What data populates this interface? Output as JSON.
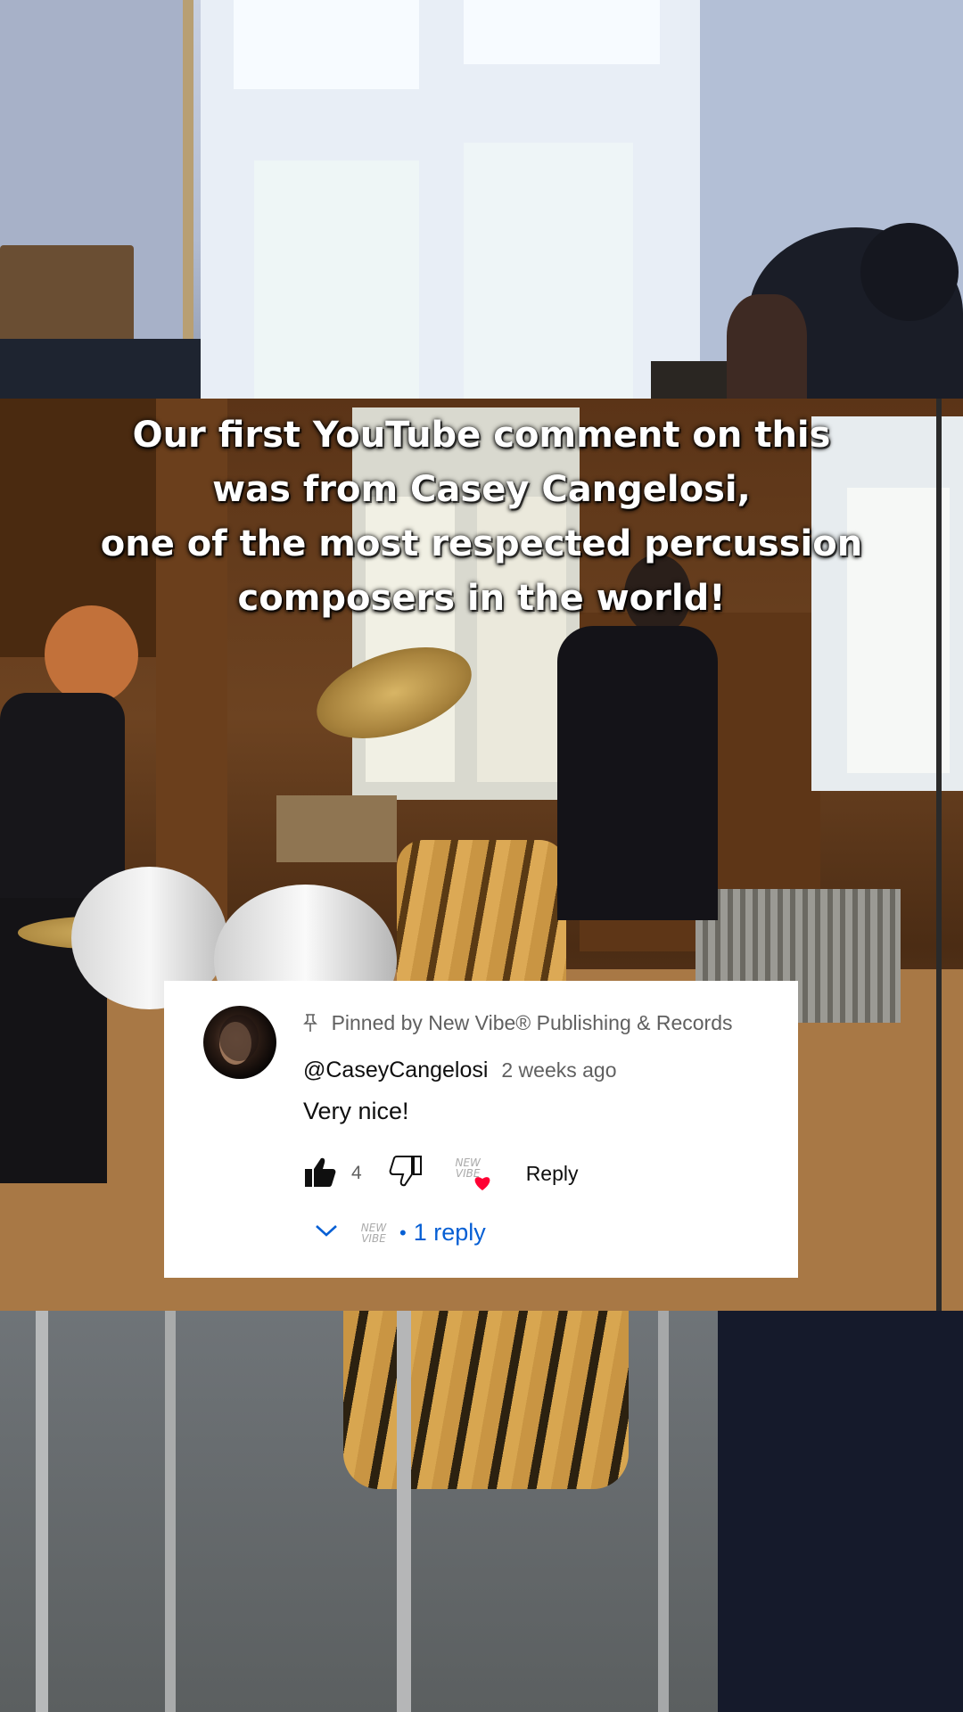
{
  "caption": {
    "line1": "Our first YouTube comment on this",
    "line2": "was from Casey Cangelosi,",
    "line3": "one of the most respected percussion",
    "line4": "composers in the world!"
  },
  "comment": {
    "pinned_label": "Pinned by New Vibe® Publishing & Records",
    "author": "@CaseyCangelosi",
    "time": "2 weeks ago",
    "text": "Very nice!",
    "like_count": "4",
    "reply_label": "Reply",
    "replies_label": "1 reply",
    "separator": "•"
  },
  "icons": {
    "pin": "pin-icon",
    "like": "thumbs-up-icon",
    "dislike": "thumbs-down-icon",
    "creator_heart": "creator-heart-icon",
    "expand": "chevron-down-icon"
  },
  "colors": {
    "link_blue": "#065fd4",
    "heart_red": "#ff0033",
    "secondary_text": "#606060"
  }
}
